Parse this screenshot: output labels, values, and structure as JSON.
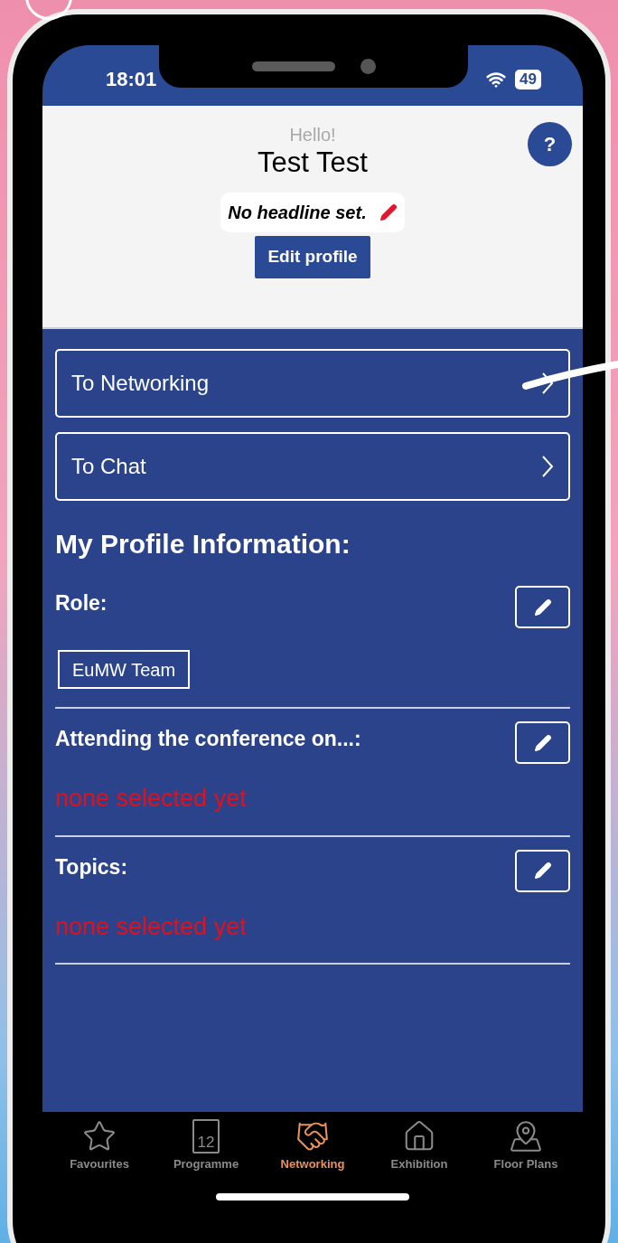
{
  "status_bar": {
    "time": "18:01",
    "battery": "49"
  },
  "header": {
    "greeting": "Hello!",
    "name": "Test Test",
    "headline": "No headline set.",
    "edit_button": "Edit profile",
    "help_button": "?"
  },
  "nav_links": [
    {
      "label": "To Networking"
    },
    {
      "label": "To Chat"
    }
  ],
  "profile": {
    "title": "My Profile Information:",
    "sections": [
      {
        "label": "Role:",
        "tags": [
          "EuMW Team"
        ]
      },
      {
        "label": "Attending the conference on...:",
        "empty_text": "none selected yet"
      },
      {
        "label": "Topics:",
        "empty_text": "none selected yet"
      }
    ]
  },
  "tab_bar": [
    {
      "label": "Favourites",
      "kind": "star",
      "selected": false
    },
    {
      "label": "Programme",
      "kind": "calendar",
      "day": "12",
      "selected": false
    },
    {
      "label": "Networking",
      "kind": "handshake",
      "selected": true
    },
    {
      "label": "Exhibition",
      "kind": "house",
      "selected": false
    },
    {
      "label": "Floor Plans",
      "kind": "map",
      "selected": false
    }
  ]
}
